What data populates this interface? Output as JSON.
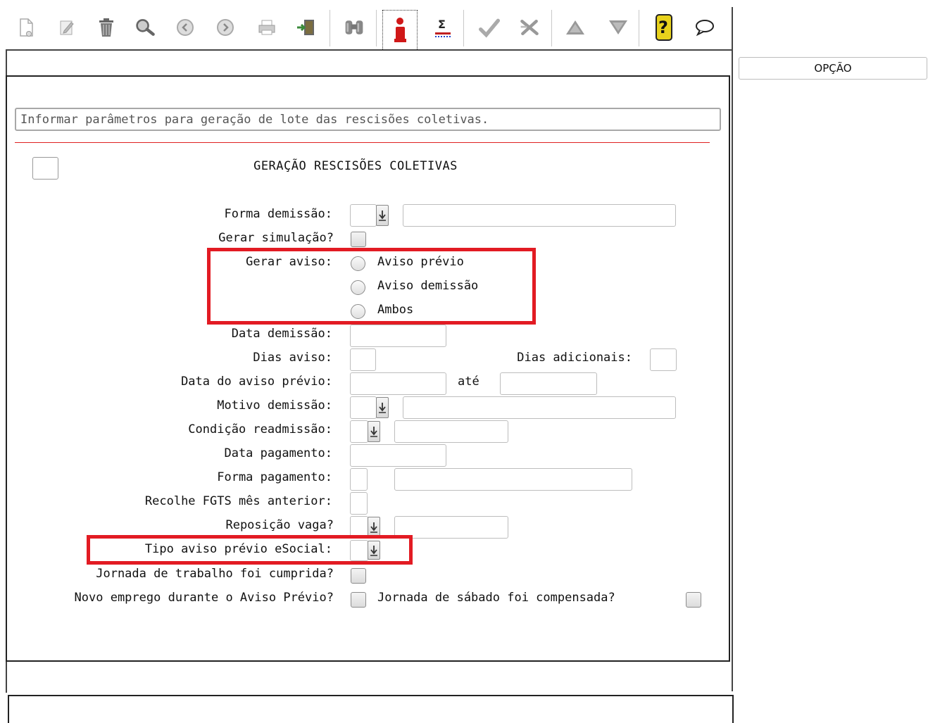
{
  "toolbar": {
    "icons": [
      {
        "name": "new-icon",
        "glyph": "🗋"
      },
      {
        "name": "edit-icon",
        "glyph": "✎"
      },
      {
        "name": "delete-icon",
        "glyph": "🗑"
      },
      {
        "name": "search-icon",
        "glyph": "🔍"
      },
      {
        "name": "previous-icon",
        "glyph": "◀"
      },
      {
        "name": "next-icon",
        "glyph": "▶"
      },
      {
        "name": "print-icon",
        "glyph": "⎙"
      },
      {
        "name": "exit-icon",
        "glyph": "⇥"
      },
      {
        "name": "binoculars-icon",
        "glyph": "⛶"
      },
      {
        "name": "info-icon",
        "glyph": "i"
      },
      {
        "name": "sigma-icon",
        "glyph": "Σ"
      },
      {
        "name": "confirm-icon",
        "glyph": "✔"
      },
      {
        "name": "cancel-icon",
        "glyph": "✘"
      },
      {
        "name": "up-icon",
        "glyph": "▲"
      },
      {
        "name": "down-icon",
        "glyph": "▼"
      },
      {
        "name": "help-icon",
        "glyph": "?"
      },
      {
        "name": "comment-icon",
        "glyph": "💬"
      }
    ]
  },
  "side": {
    "opcao_label": "OPÇÃO"
  },
  "info_text": "Informar parâmetros para geração de lote das rescisões coletivas.",
  "form": {
    "title": "GERAÇÃO RESCISÕES COLETIVAS",
    "labels": {
      "forma_demissao": "Forma demissão:",
      "gerar_simulacao": "Gerar simulação?",
      "gerar_aviso": "Gerar aviso:",
      "data_demissao": "Data demissão:",
      "dias_aviso": "Dias aviso:",
      "dias_adicionais": "Dias adicionais:",
      "data_aviso_previo": "Data do aviso prévio:",
      "ate": "até",
      "motivo_demissao": "Motivo demissão:",
      "condicao_readmissao": "Condição readmissão:",
      "data_pagamento": "Data pagamento:",
      "forma_pagamento": "Forma pagamento:",
      "recolhe_fgts": "Recolhe FGTS mês anterior:",
      "reposicao_vaga": "Reposição vaga?",
      "tipo_aviso_esocial": "Tipo aviso prévio eSocial:",
      "jornada_cumprida": "Jornada de trabalho foi cumprida?",
      "novo_emprego": "Novo emprego durante o Aviso Prévio?",
      "jornada_sabado": "Jornada de sábado foi compensada?"
    },
    "gerar_aviso_options": [
      "Aviso prévio",
      "Aviso demissão",
      "Ambos"
    ],
    "values": {
      "forma_demissao": "",
      "forma_demissao_desc": "",
      "data_demissao": "",
      "dias_aviso": "",
      "dias_adicionais": "",
      "data_aviso_inicio": "",
      "data_aviso_fim": "",
      "motivo_demissao": "",
      "motivo_demissao_desc": "",
      "condicao_readmissao": "",
      "condicao_readmissao_desc": "",
      "data_pagamento": "",
      "forma_pagamento": "",
      "forma_pagamento_desc": "",
      "recolhe_fgts": "",
      "reposicao_vaga": "",
      "reposicao_vaga_desc": "",
      "tipo_aviso_esocial": ""
    }
  },
  "colors": {
    "highlight": "#e21b23",
    "separator": "#e02020"
  }
}
